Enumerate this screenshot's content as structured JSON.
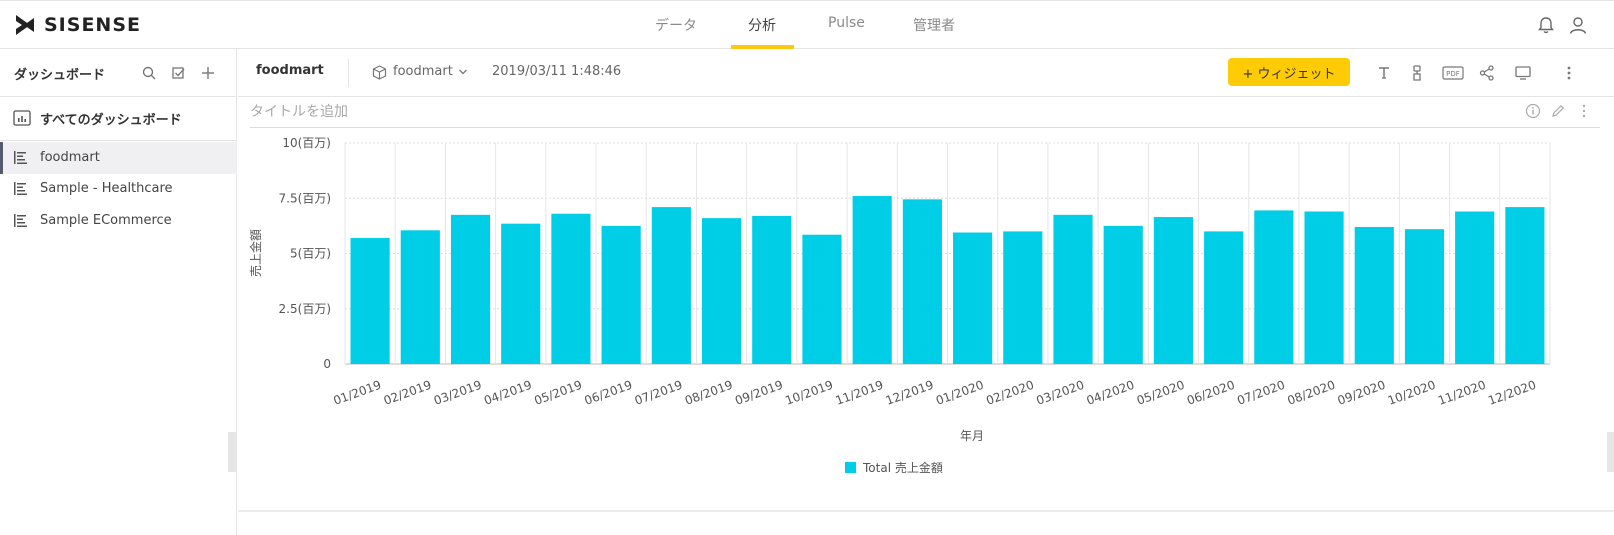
{
  "app": {
    "logo": "SISENSE"
  },
  "nav": {
    "tabs": [
      "データ",
      "分析",
      "Pulse",
      "管理者"
    ],
    "active_index": 1
  },
  "sidebar": {
    "title": "ダッシュボード",
    "all_label": "すべてのダッシュボード",
    "items": [
      {
        "label": "foodmart",
        "selected": true
      },
      {
        "label": "Sample - Healthcare",
        "selected": false
      },
      {
        "label": "Sample ECommerce",
        "selected": false
      }
    ]
  },
  "dashboard": {
    "title": "foodmart",
    "model": "foodmart",
    "timestamp": "2019/03/11 1:48:46",
    "add_widget_label": "+ ウィジェット"
  },
  "widget": {
    "title_placeholder": "タイトルを追加"
  },
  "colors": {
    "accent": "#ffcb05",
    "bar": "#00cee6"
  },
  "chart_data": {
    "type": "bar",
    "categories": [
      "01/2019",
      "02/2019",
      "03/2019",
      "04/2019",
      "05/2019",
      "06/2019",
      "07/2019",
      "08/2019",
      "09/2019",
      "10/2019",
      "11/2019",
      "12/2019",
      "01/2020",
      "02/2020",
      "03/2020",
      "04/2020",
      "05/2020",
      "06/2020",
      "07/2020",
      "08/2020",
      "09/2020",
      "10/2020",
      "11/2020",
      "12/2020"
    ],
    "series": [
      {
        "name": "Total 売上金額",
        "values": [
          5.7,
          6.05,
          6.75,
          6.35,
          6.8,
          6.25,
          7.1,
          6.6,
          6.7,
          5.85,
          7.6,
          7.45,
          5.95,
          6.0,
          6.75,
          6.25,
          6.65,
          6.0,
          6.95,
          6.9,
          6.2,
          6.1,
          6.9,
          7.1
        ]
      }
    ],
    "ylabel": "売上金額",
    "xlabel": "年月",
    "ylim": [
      0,
      10
    ],
    "yticks": [
      0,
      2.5,
      5,
      7.5,
      10
    ],
    "ytick_labels": [
      "0",
      "2.5(百万)",
      "5(百万)",
      "7.5(百万)",
      "10(百万)"
    ],
    "grid": true,
    "legend": "bottom"
  }
}
